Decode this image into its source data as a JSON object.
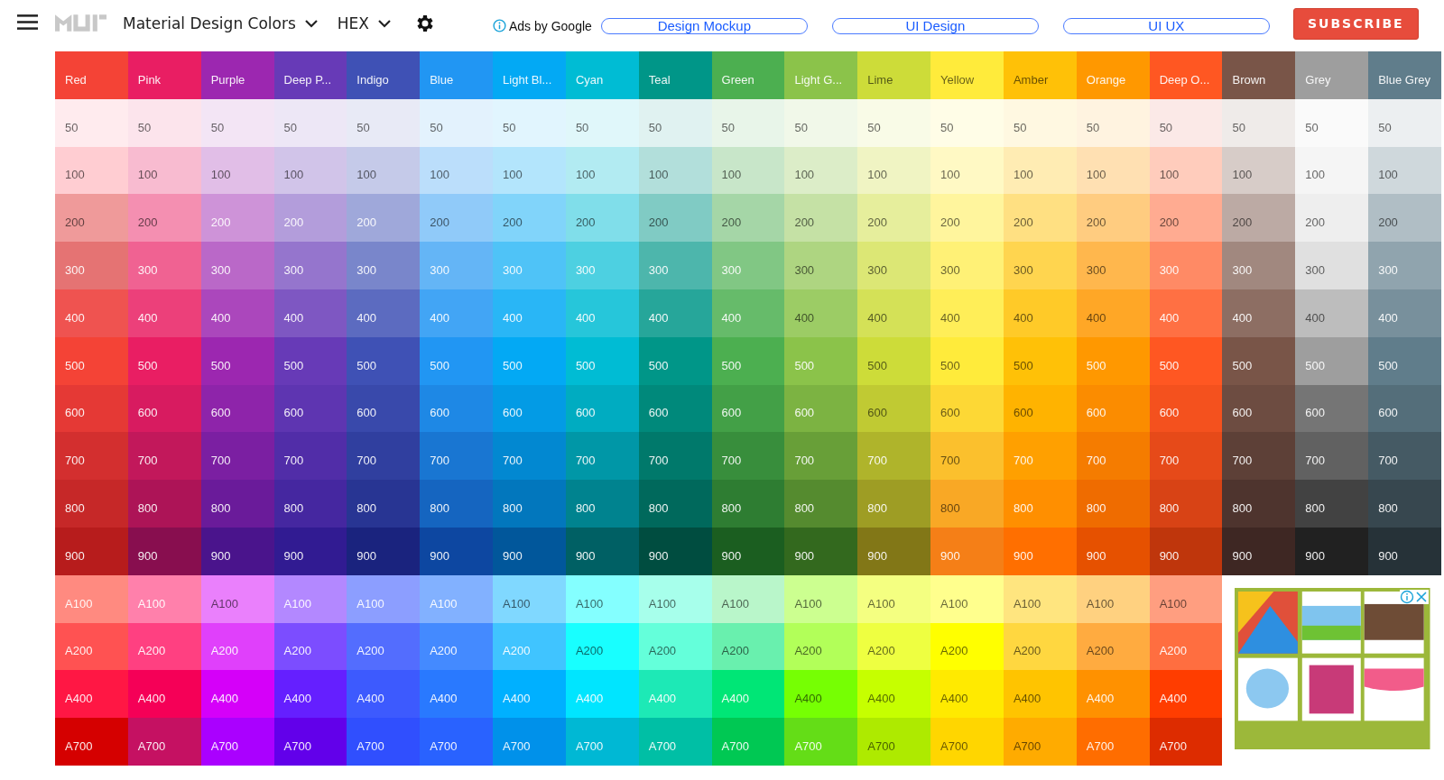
{
  "header": {
    "app_title": "Material Design Colors",
    "format": "HEX",
    "ads_label": "Ads by Google",
    "links": [
      "Design Mockup",
      "UI Design",
      "UI UX"
    ],
    "subscribe": "SUBSCRIBE"
  },
  "columns": [
    {
      "name": "Red",
      "color": "#f44336",
      "cells": [
        {
          "label": "50",
          "color": "#ffebee"
        },
        {
          "label": "100",
          "color": "#ffcdd2"
        },
        {
          "label": "200",
          "color": "#ef9a9a"
        },
        {
          "label": "300",
          "color": "#e57373"
        },
        {
          "label": "400",
          "color": "#ef5350"
        },
        {
          "label": "500",
          "color": "#f44336"
        },
        {
          "label": "600",
          "color": "#e53935"
        },
        {
          "label": "700",
          "color": "#d32f2f"
        },
        {
          "label": "800",
          "color": "#c62828"
        },
        {
          "label": "900",
          "color": "#b71c1c"
        },
        {
          "label": "A100",
          "color": "#ff8a80"
        },
        {
          "label": "A200",
          "color": "#ff5252"
        },
        {
          "label": "A400",
          "color": "#ff1744"
        },
        {
          "label": "A700",
          "color": "#d50000"
        }
      ]
    },
    {
      "name": "Pink",
      "color": "#e91e63",
      "cells": [
        {
          "label": "50",
          "color": "#fce4ec"
        },
        {
          "label": "100",
          "color": "#f8bbd0"
        },
        {
          "label": "200",
          "color": "#f48fb1"
        },
        {
          "label": "300",
          "color": "#f06292"
        },
        {
          "label": "400",
          "color": "#ec407a"
        },
        {
          "label": "500",
          "color": "#e91e63"
        },
        {
          "label": "600",
          "color": "#d81b60"
        },
        {
          "label": "700",
          "color": "#c2185b"
        },
        {
          "label": "800",
          "color": "#ad1457"
        },
        {
          "label": "900",
          "color": "#880e4f"
        },
        {
          "label": "A100",
          "color": "#ff80ab"
        },
        {
          "label": "A200",
          "color": "#ff4081"
        },
        {
          "label": "A400",
          "color": "#f50057"
        },
        {
          "label": "A700",
          "color": "#c51162"
        }
      ]
    },
    {
      "name": "Purple",
      "color": "#9c27b0",
      "cells": [
        {
          "label": "50",
          "color": "#f3e5f5"
        },
        {
          "label": "100",
          "color": "#e1bee7"
        },
        {
          "label": "200",
          "color": "#ce93d8"
        },
        {
          "label": "300",
          "color": "#ba68c8"
        },
        {
          "label": "400",
          "color": "#ab47bc"
        },
        {
          "label": "500",
          "color": "#9c27b0"
        },
        {
          "label": "600",
          "color": "#8e24aa"
        },
        {
          "label": "700",
          "color": "#7b1fa2"
        },
        {
          "label": "800",
          "color": "#6a1b9a"
        },
        {
          "label": "900",
          "color": "#4a148c"
        },
        {
          "label": "A100",
          "color": "#ea80fc"
        },
        {
          "label": "A200",
          "color": "#e040fb"
        },
        {
          "label": "A400",
          "color": "#d500f9"
        },
        {
          "label": "A700",
          "color": "#aa00ff"
        }
      ]
    },
    {
      "name": "Deep P...",
      "color": "#673ab7",
      "cells": [
        {
          "label": "50",
          "color": "#ede7f6"
        },
        {
          "label": "100",
          "color": "#d1c4e9"
        },
        {
          "label": "200",
          "color": "#b39ddb"
        },
        {
          "label": "300",
          "color": "#9575cd"
        },
        {
          "label": "400",
          "color": "#7e57c2"
        },
        {
          "label": "500",
          "color": "#673ab7"
        },
        {
          "label": "600",
          "color": "#5e35b1"
        },
        {
          "label": "700",
          "color": "#512da8"
        },
        {
          "label": "800",
          "color": "#4527a0"
        },
        {
          "label": "900",
          "color": "#311b92"
        },
        {
          "label": "A100",
          "color": "#b388ff"
        },
        {
          "label": "A200",
          "color": "#7c4dff"
        },
        {
          "label": "A400",
          "color": "#651fff"
        },
        {
          "label": "A700",
          "color": "#6200ea"
        }
      ]
    },
    {
      "name": "Indigo",
      "color": "#3f51b5",
      "cells": [
        {
          "label": "50",
          "color": "#e8eaf6"
        },
        {
          "label": "100",
          "color": "#c5cae9"
        },
        {
          "label": "200",
          "color": "#9fa8da"
        },
        {
          "label": "300",
          "color": "#7986cb"
        },
        {
          "label": "400",
          "color": "#5c6bc0"
        },
        {
          "label": "500",
          "color": "#3f51b5"
        },
        {
          "label": "600",
          "color": "#3949ab"
        },
        {
          "label": "700",
          "color": "#303f9f"
        },
        {
          "label": "800",
          "color": "#283593"
        },
        {
          "label": "900",
          "color": "#1a237e"
        },
        {
          "label": "A100",
          "color": "#8c9eff"
        },
        {
          "label": "A200",
          "color": "#536dfe"
        },
        {
          "label": "A400",
          "color": "#3d5afe"
        },
        {
          "label": "A700",
          "color": "#304ffe"
        }
      ]
    },
    {
      "name": "Blue",
      "color": "#2196f3",
      "cells": [
        {
          "label": "50",
          "color": "#e3f2fd"
        },
        {
          "label": "100",
          "color": "#bbdefb"
        },
        {
          "label": "200",
          "color": "#90caf9"
        },
        {
          "label": "300",
          "color": "#64b5f6"
        },
        {
          "label": "400",
          "color": "#42a5f5"
        },
        {
          "label": "500",
          "color": "#2196f3"
        },
        {
          "label": "600",
          "color": "#1e88e5"
        },
        {
          "label": "700",
          "color": "#1976d2"
        },
        {
          "label": "800",
          "color": "#1565c0"
        },
        {
          "label": "900",
          "color": "#0d47a1"
        },
        {
          "label": "A100",
          "color": "#82b1ff"
        },
        {
          "label": "A200",
          "color": "#448aff"
        },
        {
          "label": "A400",
          "color": "#2979ff"
        },
        {
          "label": "A700",
          "color": "#2962ff"
        }
      ]
    },
    {
      "name": "Light Bl...",
      "color": "#03a9f4",
      "cells": [
        {
          "label": "50",
          "color": "#e1f5fe"
        },
        {
          "label": "100",
          "color": "#b3e5fc"
        },
        {
          "label": "200",
          "color": "#81d4fa"
        },
        {
          "label": "300",
          "color": "#4fc3f7"
        },
        {
          "label": "400",
          "color": "#29b6f6"
        },
        {
          "label": "500",
          "color": "#03a9f4"
        },
        {
          "label": "600",
          "color": "#039be5"
        },
        {
          "label": "700",
          "color": "#0288d1"
        },
        {
          "label": "800",
          "color": "#0277bd"
        },
        {
          "label": "900",
          "color": "#01579b"
        },
        {
          "label": "A100",
          "color": "#80d8ff"
        },
        {
          "label": "A200",
          "color": "#40c4ff"
        },
        {
          "label": "A400",
          "color": "#00b0ff"
        },
        {
          "label": "A700",
          "color": "#0091ea"
        }
      ]
    },
    {
      "name": "Cyan",
      "color": "#00bcd4",
      "cells": [
        {
          "label": "50",
          "color": "#e0f7fa"
        },
        {
          "label": "100",
          "color": "#b2ebf2"
        },
        {
          "label": "200",
          "color": "#80deea"
        },
        {
          "label": "300",
          "color": "#4dd0e1"
        },
        {
          "label": "400",
          "color": "#26c6da"
        },
        {
          "label": "500",
          "color": "#00bcd4"
        },
        {
          "label": "600",
          "color": "#00acc1"
        },
        {
          "label": "700",
          "color": "#0097a7"
        },
        {
          "label": "800",
          "color": "#00838f"
        },
        {
          "label": "900",
          "color": "#006064"
        },
        {
          "label": "A100",
          "color": "#84ffff"
        },
        {
          "label": "A200",
          "color": "#18ffff"
        },
        {
          "label": "A400",
          "color": "#00e5ff"
        },
        {
          "label": "A700",
          "color": "#00b8d4"
        }
      ]
    },
    {
      "name": "Teal",
      "color": "#009688",
      "cells": [
        {
          "label": "50",
          "color": "#e0f2f1"
        },
        {
          "label": "100",
          "color": "#b2dfdb"
        },
        {
          "label": "200",
          "color": "#80cbc4"
        },
        {
          "label": "300",
          "color": "#4db6ac"
        },
        {
          "label": "400",
          "color": "#26a69a"
        },
        {
          "label": "500",
          "color": "#009688"
        },
        {
          "label": "600",
          "color": "#00897b"
        },
        {
          "label": "700",
          "color": "#00796b"
        },
        {
          "label": "800",
          "color": "#00695c"
        },
        {
          "label": "900",
          "color": "#004d40"
        },
        {
          "label": "A100",
          "color": "#a7ffeb"
        },
        {
          "label": "A200",
          "color": "#64ffda"
        },
        {
          "label": "A400",
          "color": "#1de9b6"
        },
        {
          "label": "A700",
          "color": "#00bfa5"
        }
      ]
    },
    {
      "name": "Green",
      "color": "#4caf50",
      "cells": [
        {
          "label": "50",
          "color": "#e8f5e9"
        },
        {
          "label": "100",
          "color": "#c8e6c9"
        },
        {
          "label": "200",
          "color": "#a5d6a7"
        },
        {
          "label": "300",
          "color": "#81c784"
        },
        {
          "label": "400",
          "color": "#66bb6a"
        },
        {
          "label": "500",
          "color": "#4caf50"
        },
        {
          "label": "600",
          "color": "#43a047"
        },
        {
          "label": "700",
          "color": "#388e3c"
        },
        {
          "label": "800",
          "color": "#2e7d32"
        },
        {
          "label": "900",
          "color": "#1b5e20"
        },
        {
          "label": "A100",
          "color": "#b9f6ca"
        },
        {
          "label": "A200",
          "color": "#69f0ae"
        },
        {
          "label": "A400",
          "color": "#00e676"
        },
        {
          "label": "A700",
          "color": "#00c853"
        }
      ]
    },
    {
      "name": "Light G...",
      "color": "#8bc34a",
      "cells": [
        {
          "label": "50",
          "color": "#f1f8e9"
        },
        {
          "label": "100",
          "color": "#dcedc8"
        },
        {
          "label": "200",
          "color": "#c5e1a5"
        },
        {
          "label": "300",
          "color": "#aed581"
        },
        {
          "label": "400",
          "color": "#9ccc65"
        },
        {
          "label": "500",
          "color": "#8bc34a"
        },
        {
          "label": "600",
          "color": "#7cb342"
        },
        {
          "label": "700",
          "color": "#689f38"
        },
        {
          "label": "800",
          "color": "#558b2f"
        },
        {
          "label": "900",
          "color": "#33691e"
        },
        {
          "label": "A100",
          "color": "#ccff90"
        },
        {
          "label": "A200",
          "color": "#b2ff59"
        },
        {
          "label": "A400",
          "color": "#76ff03"
        },
        {
          "label": "A700",
          "color": "#64dd17"
        }
      ]
    },
    {
      "name": "Lime",
      "color": "#cddc39",
      "cells": [
        {
          "label": "50",
          "color": "#f9fbe7"
        },
        {
          "label": "100",
          "color": "#f0f4c3"
        },
        {
          "label": "200",
          "color": "#e6ee9c"
        },
        {
          "label": "300",
          "color": "#dce775"
        },
        {
          "label": "400",
          "color": "#d4e157"
        },
        {
          "label": "500",
          "color": "#cddc39"
        },
        {
          "label": "600",
          "color": "#c0ca33"
        },
        {
          "label": "700",
          "color": "#afb42b"
        },
        {
          "label": "800",
          "color": "#9e9d24"
        },
        {
          "label": "900",
          "color": "#827717"
        },
        {
          "label": "A100",
          "color": "#f4ff81"
        },
        {
          "label": "A200",
          "color": "#eeff41"
        },
        {
          "label": "A400",
          "color": "#c6ff00"
        },
        {
          "label": "A700",
          "color": "#aeea00"
        }
      ]
    },
    {
      "name": "Yellow",
      "color": "#ffeb3b",
      "cells": [
        {
          "label": "50",
          "color": "#fffde7"
        },
        {
          "label": "100",
          "color": "#fff9c4"
        },
        {
          "label": "200",
          "color": "#fff59d"
        },
        {
          "label": "300",
          "color": "#fff176"
        },
        {
          "label": "400",
          "color": "#ffee58"
        },
        {
          "label": "500",
          "color": "#ffeb3b"
        },
        {
          "label": "600",
          "color": "#fdd835"
        },
        {
          "label": "700",
          "color": "#fbc02d"
        },
        {
          "label": "800",
          "color": "#f9a825"
        },
        {
          "label": "900",
          "color": "#f57f17"
        },
        {
          "label": "A100",
          "color": "#ffff8d"
        },
        {
          "label": "A200",
          "color": "#ffff00"
        },
        {
          "label": "A400",
          "color": "#ffea00"
        },
        {
          "label": "A700",
          "color": "#ffd600"
        }
      ]
    },
    {
      "name": "Amber",
      "color": "#ffc107",
      "cells": [
        {
          "label": "50",
          "color": "#fff8e1"
        },
        {
          "label": "100",
          "color": "#ffecb3"
        },
        {
          "label": "200",
          "color": "#ffe082"
        },
        {
          "label": "300",
          "color": "#ffd54f"
        },
        {
          "label": "400",
          "color": "#ffca28"
        },
        {
          "label": "500",
          "color": "#ffc107"
        },
        {
          "label": "600",
          "color": "#ffb300"
        },
        {
          "label": "700",
          "color": "#ffa000"
        },
        {
          "label": "800",
          "color": "#ff8f00"
        },
        {
          "label": "900",
          "color": "#ff6f00"
        },
        {
          "label": "A100",
          "color": "#ffe57f"
        },
        {
          "label": "A200",
          "color": "#ffd740"
        },
        {
          "label": "A400",
          "color": "#ffc400"
        },
        {
          "label": "A700",
          "color": "#ffab00"
        }
      ]
    },
    {
      "name": "Orange",
      "color": "#ff9800",
      "cells": [
        {
          "label": "50",
          "color": "#fff3e0"
        },
        {
          "label": "100",
          "color": "#ffe0b2"
        },
        {
          "label": "200",
          "color": "#ffcc80"
        },
        {
          "label": "300",
          "color": "#ffb74d"
        },
        {
          "label": "400",
          "color": "#ffa726"
        },
        {
          "label": "500",
          "color": "#ff9800"
        },
        {
          "label": "600",
          "color": "#fb8c00"
        },
        {
          "label": "700",
          "color": "#f57c00"
        },
        {
          "label": "800",
          "color": "#ef6c00"
        },
        {
          "label": "900",
          "color": "#e65100"
        },
        {
          "label": "A100",
          "color": "#ffd180"
        },
        {
          "label": "A200",
          "color": "#ffab40"
        },
        {
          "label": "A400",
          "color": "#ff9100"
        },
        {
          "label": "A700",
          "color": "#ff6d00"
        }
      ]
    },
    {
      "name": "Deep O...",
      "color": "#ff5722",
      "cells": [
        {
          "label": "50",
          "color": "#fbe9e7"
        },
        {
          "label": "100",
          "color": "#ffccbc"
        },
        {
          "label": "200",
          "color": "#ffab91"
        },
        {
          "label": "300",
          "color": "#ff8a65"
        },
        {
          "label": "400",
          "color": "#ff7043"
        },
        {
          "label": "500",
          "color": "#ff5722"
        },
        {
          "label": "600",
          "color": "#f4511e"
        },
        {
          "label": "700",
          "color": "#e64a19"
        },
        {
          "label": "800",
          "color": "#d84315"
        },
        {
          "label": "900",
          "color": "#bf360c"
        },
        {
          "label": "A100",
          "color": "#ff9e80"
        },
        {
          "label": "A200",
          "color": "#ff6e40"
        },
        {
          "label": "A400",
          "color": "#ff3d00"
        },
        {
          "label": "A700",
          "color": "#dd2c00"
        }
      ]
    },
    {
      "name": "Brown",
      "color": "#795548",
      "cells": [
        {
          "label": "50",
          "color": "#efebe9"
        },
        {
          "label": "100",
          "color": "#d7ccc8"
        },
        {
          "label": "200",
          "color": "#bcaaa4"
        },
        {
          "label": "300",
          "color": "#a1887f"
        },
        {
          "label": "400",
          "color": "#8d6e63"
        },
        {
          "label": "500",
          "color": "#795548"
        },
        {
          "label": "600",
          "color": "#6d4c41"
        },
        {
          "label": "700",
          "color": "#5d4037"
        },
        {
          "label": "800",
          "color": "#4e342e"
        },
        {
          "label": "900",
          "color": "#3e2723"
        }
      ]
    },
    {
      "name": "Grey",
      "color": "#9e9e9e",
      "cells": [
        {
          "label": "50",
          "color": "#fafafa"
        },
        {
          "label": "100",
          "color": "#f5f5f5"
        },
        {
          "label": "200",
          "color": "#eeeeee"
        },
        {
          "label": "300",
          "color": "#e0e0e0"
        },
        {
          "label": "400",
          "color": "#bdbdbd"
        },
        {
          "label": "500",
          "color": "#9e9e9e"
        },
        {
          "label": "600",
          "color": "#757575"
        },
        {
          "label": "700",
          "color": "#616161"
        },
        {
          "label": "800",
          "color": "#424242"
        },
        {
          "label": "900",
          "color": "#212121"
        }
      ]
    },
    {
      "name": "Blue Grey",
      "color": "#607d8b",
      "cells": [
        {
          "label": "50",
          "color": "#eceff1"
        },
        {
          "label": "100",
          "color": "#cfd8dc"
        },
        {
          "label": "200",
          "color": "#b0bec5"
        },
        {
          "label": "300",
          "color": "#90a4ae"
        },
        {
          "label": "400",
          "color": "#78909c"
        },
        {
          "label": "500",
          "color": "#607d8b"
        },
        {
          "label": "600",
          "color": "#546e7a"
        },
        {
          "label": "700",
          "color": "#455a64"
        },
        {
          "label": "800",
          "color": "#37474f"
        },
        {
          "label": "900",
          "color": "#263238"
        }
      ]
    }
  ]
}
